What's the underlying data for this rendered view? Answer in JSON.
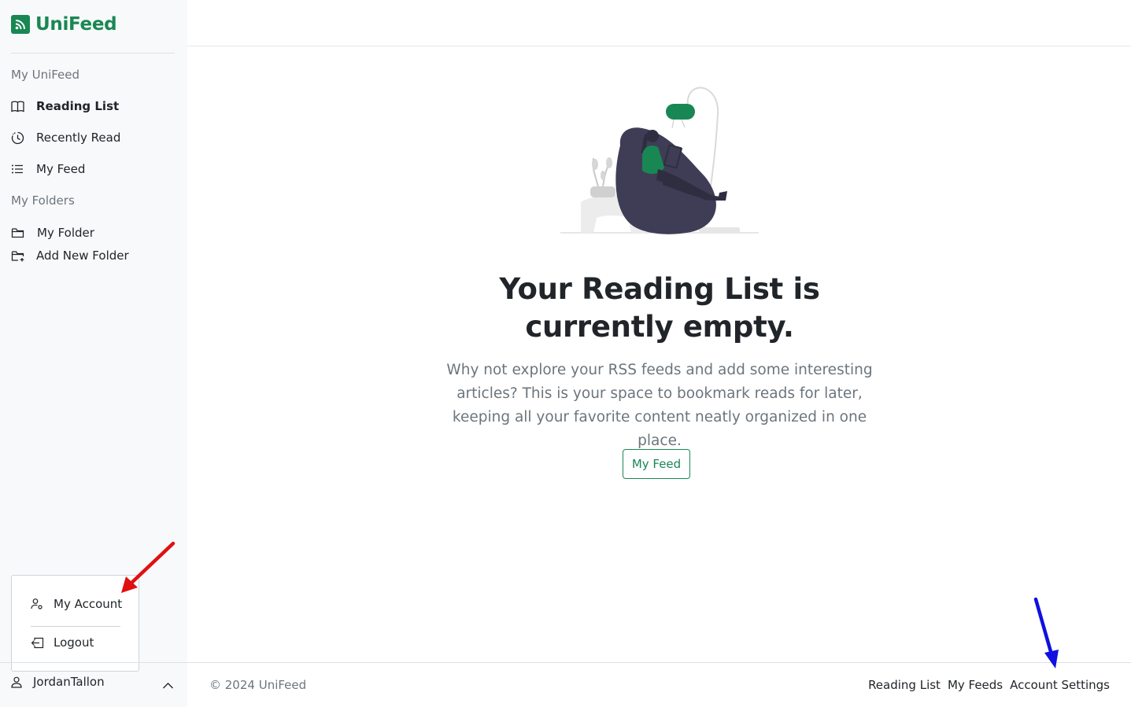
{
  "brand": {
    "name": "UniFeed",
    "icon": "rss-icon",
    "color": "#198754"
  },
  "sidebar": {
    "my_unifeed_label": "My UniFeed",
    "items": [
      {
        "label": "Reading List",
        "icon": "book-icon",
        "active": true
      },
      {
        "label": "Recently Read",
        "icon": "clock-history-icon",
        "active": false
      },
      {
        "label": "My Feed",
        "icon": "list-icon",
        "active": false
      }
    ],
    "my_folders_label": "My Folders",
    "folders": [
      {
        "label": "My Folder",
        "icon": "folder-icon"
      },
      {
        "label": "Add New Folder",
        "icon": "folder-plus-icon"
      }
    ]
  },
  "account_menu": {
    "my_account": "My Account",
    "logout": "Logout"
  },
  "user": {
    "name": "JordanTallon",
    "icon": "person-icon"
  },
  "main": {
    "empty_title": "Your Reading List is currently empty.",
    "empty_description": "Why not explore your RSS feeds and add some interesting articles? This is your space to bookmark reads for later, keeping all your favorite content neatly organized in one place.",
    "cta_label": "My Feed"
  },
  "footer": {
    "copyright": "© 2024 UniFeed",
    "links": [
      "Reading List",
      "My Feeds",
      "Account Settings"
    ]
  },
  "colors": {
    "accent": "#198754",
    "muted": "#6c757d",
    "annotation_red": "#e01010",
    "annotation_blue": "#1010e0"
  }
}
